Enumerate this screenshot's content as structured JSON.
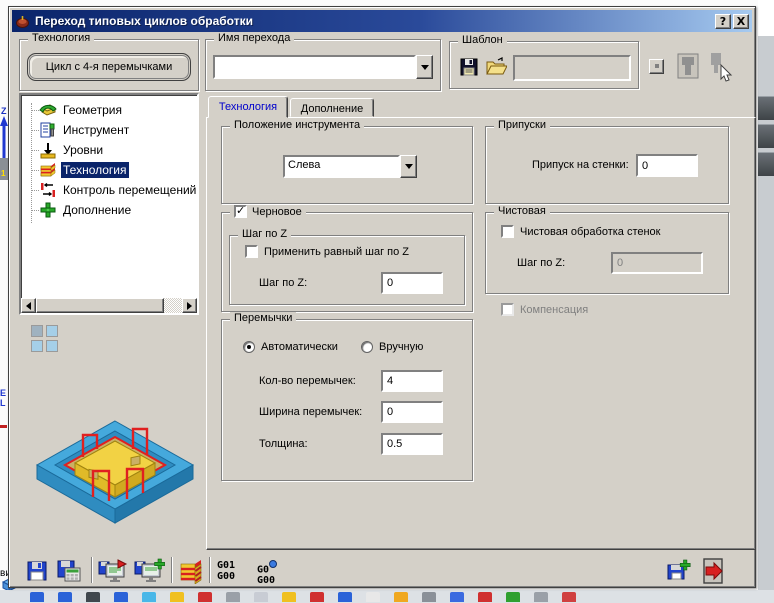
{
  "window": {
    "title": "Переход типовых циклов обработки",
    "help": "?",
    "close": "X"
  },
  "header": {
    "technology": {
      "label": "Технология",
      "cycle_button": "Цикл с 4-я перемычками"
    },
    "transition_name": {
      "label": "Имя перехода",
      "value": ""
    },
    "template": {
      "label": "Шаблон",
      "field_value": ""
    }
  },
  "tree": {
    "selected": "Технология",
    "items": [
      {
        "label": "Геометрия",
        "icon": "geometry-icon"
      },
      {
        "label": "Инструмент",
        "icon": "tool-icon"
      },
      {
        "label": "Уровни",
        "icon": "levels-icon"
      },
      {
        "label": "Технология",
        "icon": "technology-icon"
      },
      {
        "label": "Контроль перемещений",
        "icon": "motion-control-icon"
      },
      {
        "label": "Дополнение",
        "icon": "addition-icon"
      }
    ]
  },
  "tabs": {
    "technology": "Технология",
    "addition": "Дополнение",
    "active": "Технология"
  },
  "panel": {
    "tool_position": {
      "label": "Положение инструмента",
      "value": "Слева"
    },
    "allowances": {
      "label": "Припуски",
      "wall_label": "Припуск на стенки:",
      "wall_value": "0"
    },
    "roughing": {
      "label": "Черновое",
      "checked": true,
      "zstep": {
        "label": "Шаг по Z",
        "equal_label": "Применить равный шаг по Z",
        "equal_checked": false,
        "step_label": "Шаг по Z:",
        "step_value": "0"
      }
    },
    "finishing": {
      "label": "Чистовая",
      "wall_finish_label": "Чистовая обработка стенок",
      "checked": false,
      "step_label": "Шаг по Z:",
      "step_value": "0",
      "step_enabled": false
    },
    "compensation": {
      "label": "Компенсация",
      "checked": false,
      "enabled": false
    },
    "bridges": {
      "label": "Перемычки",
      "auto": "Автоматически",
      "manual": "Вручную",
      "selected": "Автоматически",
      "count_label": "Кол-во перемычек:",
      "count_value": "4",
      "width_label": "Ширина перемычек:",
      "width_value": "0",
      "thickness_label": "Толщина:",
      "thickness_value": "0.5"
    }
  },
  "toolbar": {
    "icons": [
      "save-icon",
      "save-calc-icon",
      "export-program-icon",
      "add-program-icon",
      "layers-icon",
      "gcode-linear-icon",
      "gcode-rapid-icon",
      "save-new-icon",
      "exit-icon"
    ],
    "g1_top": "G01",
    "g1_bottom": "G00",
    "g2_top": "G0",
    "g2_bottom": "G00"
  },
  "background": {
    "z_axis_label": "Z",
    "fragment_text": "ви",
    "bottom_icon_colors": [
      "#2a62d8",
      "#2a62d8",
      "#40474e",
      "#2a62d8",
      "#49b7e8",
      "#f0c020",
      "#d03030",
      "#9aa0a8",
      "#c8ccd4",
      "#f0c020",
      "#d03030",
      "#2a62d8",
      "#e8e8e8",
      "#f0a820",
      "#8a9098",
      "#3a6ae0",
      "#d03030",
      "#30a030",
      "#9aa0a8",
      "#d04040"
    ]
  },
  "colors": {
    "titlebar_start": "#0a246a",
    "titlebar_end": "#a6caf0",
    "face": "#d4d0c8",
    "selection": "#0a246a",
    "active_tab_text": "#0000cc",
    "preview_blue": "#3ba0d8",
    "preview_yellow": "#f2d244",
    "preview_red": "#e02020"
  }
}
